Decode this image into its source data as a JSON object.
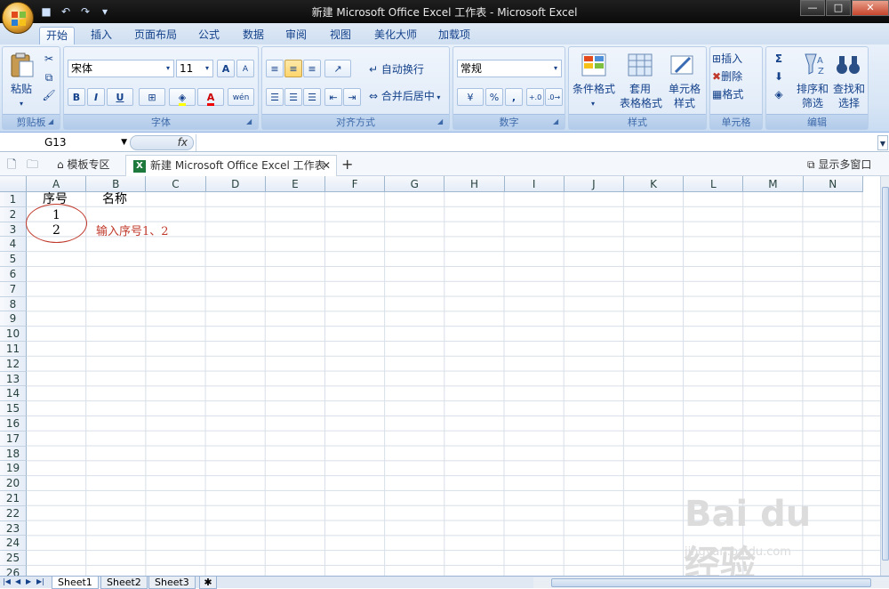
{
  "window": {
    "title": "新建 Microsoft Office Excel 工作表 - Microsoft Excel",
    "controls": [
      "—",
      "□",
      "✕"
    ]
  },
  "ribbon_tabs": [
    "开始",
    "插入",
    "页面布局",
    "公式",
    "数据",
    "审阅",
    "视图",
    "美化大师",
    "加载项"
  ],
  "ribbon": {
    "clipboard": {
      "label": "剪贴板",
      "paste": "粘贴"
    },
    "font": {
      "label": "字体",
      "name": "宋体",
      "size": "11",
      "bold": "B",
      "italic": "I",
      "underline": "U",
      "grow": "A",
      "shrink": "A",
      "font_color": "A",
      "phonetic": "wén"
    },
    "alignment": {
      "label": "对齐方式",
      "wrap": "自动换行",
      "merge": "合并后居中"
    },
    "number": {
      "label": "数字",
      "format": "常规",
      "percent": "%",
      "comma": ","
    },
    "styles": {
      "label": "样式",
      "conditional": "条件格式",
      "table_line1": "套用",
      "table_line2": "表格格式",
      "cell_line1": "单元格",
      "cell_line2": "样式"
    },
    "cells": {
      "label": "单元格",
      "insert": "插入",
      "delete": "删除",
      "format": "格式"
    },
    "editing": {
      "label": "编辑",
      "sigma": "Σ",
      "sort_line1": "排序和",
      "sort_line2": "筛选",
      "find_line1": "查找和",
      "find_line2": "选择"
    }
  },
  "formula_bar": {
    "name_box": "G13",
    "fx": "fx",
    "value": ""
  },
  "doc_tabs": {
    "template": "模板专区",
    "active": "新建 Microsoft Office Excel 工作表",
    "plus": "+",
    "multi_window": "显示多窗口"
  },
  "columns": [
    "A",
    "B",
    "C",
    "D",
    "E",
    "F",
    "G",
    "H",
    "I",
    "J",
    "K",
    "L",
    "M",
    "N"
  ],
  "rows": [
    "1",
    "2",
    "3",
    "4",
    "5",
    "6",
    "7",
    "8",
    "9",
    "10",
    "11",
    "12",
    "13",
    "14",
    "15",
    "16",
    "17",
    "18",
    "19",
    "20",
    "21",
    "22",
    "23",
    "24",
    "25",
    "26"
  ],
  "cells": {
    "A1": "序号",
    "B1": "名称",
    "A2": "1",
    "A3": "2"
  },
  "annotation": "输入序号1、2",
  "sheets": [
    "Sheet1",
    "Sheet2",
    "Sheet3"
  ],
  "watermark": {
    "brand": "Bai du 经验",
    "url": "jingyan.baidu.com"
  }
}
